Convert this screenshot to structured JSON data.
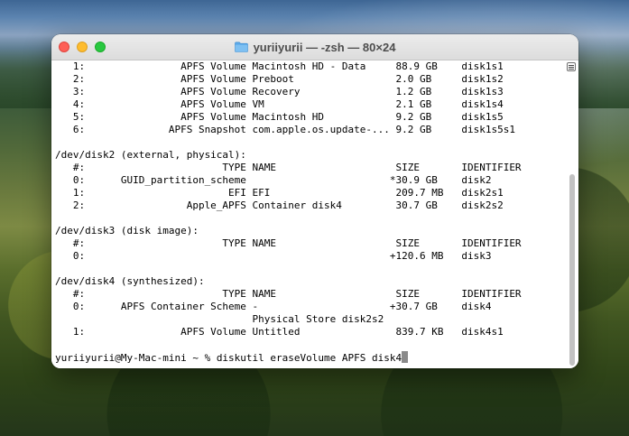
{
  "window": {
    "title": "yuriiyurii — -zsh — 80×24",
    "folder_icon": "folder-icon"
  },
  "terminal": {
    "lines": [
      "   1:                APFS Volume Macintosh HD - Data     88.9 GB    disk1s1",
      "   2:                APFS Volume Preboot                 2.0 GB     disk1s2",
      "   3:                APFS Volume Recovery                1.2 GB     disk1s3",
      "   4:                APFS Volume VM                      2.1 GB     disk1s4",
      "   5:                APFS Volume Macintosh HD            9.2 GB     disk1s5",
      "   6:              APFS Snapshot com.apple.os.update-... 9.2 GB     disk1s5s1",
      "",
      "/dev/disk2 (external, physical):",
      "   #:                       TYPE NAME                    SIZE       IDENTIFIER",
      "   0:      GUID_partition_scheme                        *30.9 GB    disk2",
      "   1:                        EFI EFI                     209.7 MB   disk2s1",
      "   2:                 Apple_APFS Container disk4         30.7 GB    disk2s2",
      "",
      "/dev/disk3 (disk image):",
      "   #:                       TYPE NAME                    SIZE       IDENTIFIER",
      "   0:                                                   +120.6 MB   disk3",
      "",
      "/dev/disk4 (synthesized):",
      "   #:                       TYPE NAME                    SIZE       IDENTIFIER",
      "   0:      APFS Container Scheme -                      +30.7 GB    disk4",
      "                                 Physical Store disk2s2",
      "   1:                APFS Volume Untitled                839.7 KB   disk4s1",
      ""
    ],
    "prompt": "yuriiyurii@My-Mac-mini ~ % ",
    "command": "diskutil eraseVolume APFS disk4"
  },
  "colors": {
    "close": "#fe5f57",
    "minimize": "#febc2e",
    "zoom": "#28c840"
  }
}
